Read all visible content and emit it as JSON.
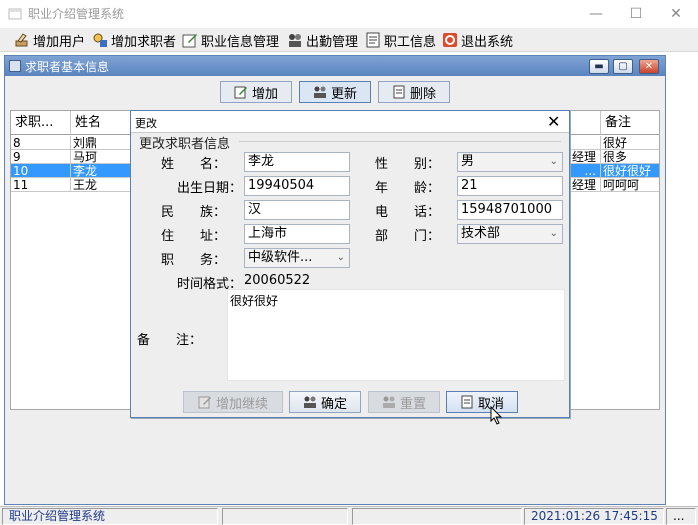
{
  "window": {
    "title": "职业介绍管理系统",
    "minimize": "—",
    "maximize": "☐",
    "close": "✕"
  },
  "menu": [
    {
      "label": "增加用户",
      "icon": "add-user-icon"
    },
    {
      "label": "增加求职者",
      "icon": "add-jobseeker-icon"
    },
    {
      "label": "职业信息管理",
      "icon": "edit-icon"
    },
    {
      "label": "出勤管理",
      "icon": "attendance-icon"
    },
    {
      "label": "职工信息",
      "icon": "staff-info-icon"
    },
    {
      "label": "退出系统",
      "icon": "exit-icon"
    }
  ],
  "inner_window": {
    "title": "求职者基本信息",
    "toolbar": {
      "add": "增加",
      "update": "更新",
      "delete": "删除"
    }
  },
  "table": {
    "headers": [
      "求职...",
      "姓名",
      "",
      "备注"
    ],
    "rows": [
      {
        "id": "8",
        "name": "刘鼎",
        "mid": "",
        "note": "很好"
      },
      {
        "id": "9",
        "name": "马珂",
        "mid": "经理",
        "note": "很多"
      },
      {
        "id": "10",
        "name": "李龙",
        "mid": "...",
        "note": "很好很好"
      },
      {
        "id": "11",
        "name": "王龙",
        "mid": "经理",
        "note": "呵呵呵"
      }
    ],
    "selected_index": 2
  },
  "dialog": {
    "title": "更改",
    "close": "✕",
    "group_title": "更改求职者信息",
    "labels": {
      "name": "姓　　名：",
      "birth": "出生日期：",
      "ethnic": "民　　族：",
      "address": "住　　址：",
      "position": "职　　务：",
      "time_format": "时间格式：",
      "remark": "备　　注：",
      "gender": "性　　别：",
      "age": "年　　龄：",
      "phone": "电　　话：",
      "dept": "部　　门："
    },
    "values": {
      "name": "李龙",
      "birth": "19940504",
      "ethnic": "汉",
      "address": "上海市",
      "position": "中级软件...",
      "time_format": "20060522",
      "remark": "很好很好",
      "gender": "男",
      "age": "21",
      "phone": "15948701000",
      "dept": "技术部"
    },
    "buttons": {
      "add_continue": "增加继续",
      "confirm": "确定",
      "reset": "重置",
      "cancel": "取消"
    }
  },
  "statusbar": {
    "app": "职业介绍管理系统",
    "datetime": "2021:01:26 17:45:15",
    "more": "..."
  }
}
